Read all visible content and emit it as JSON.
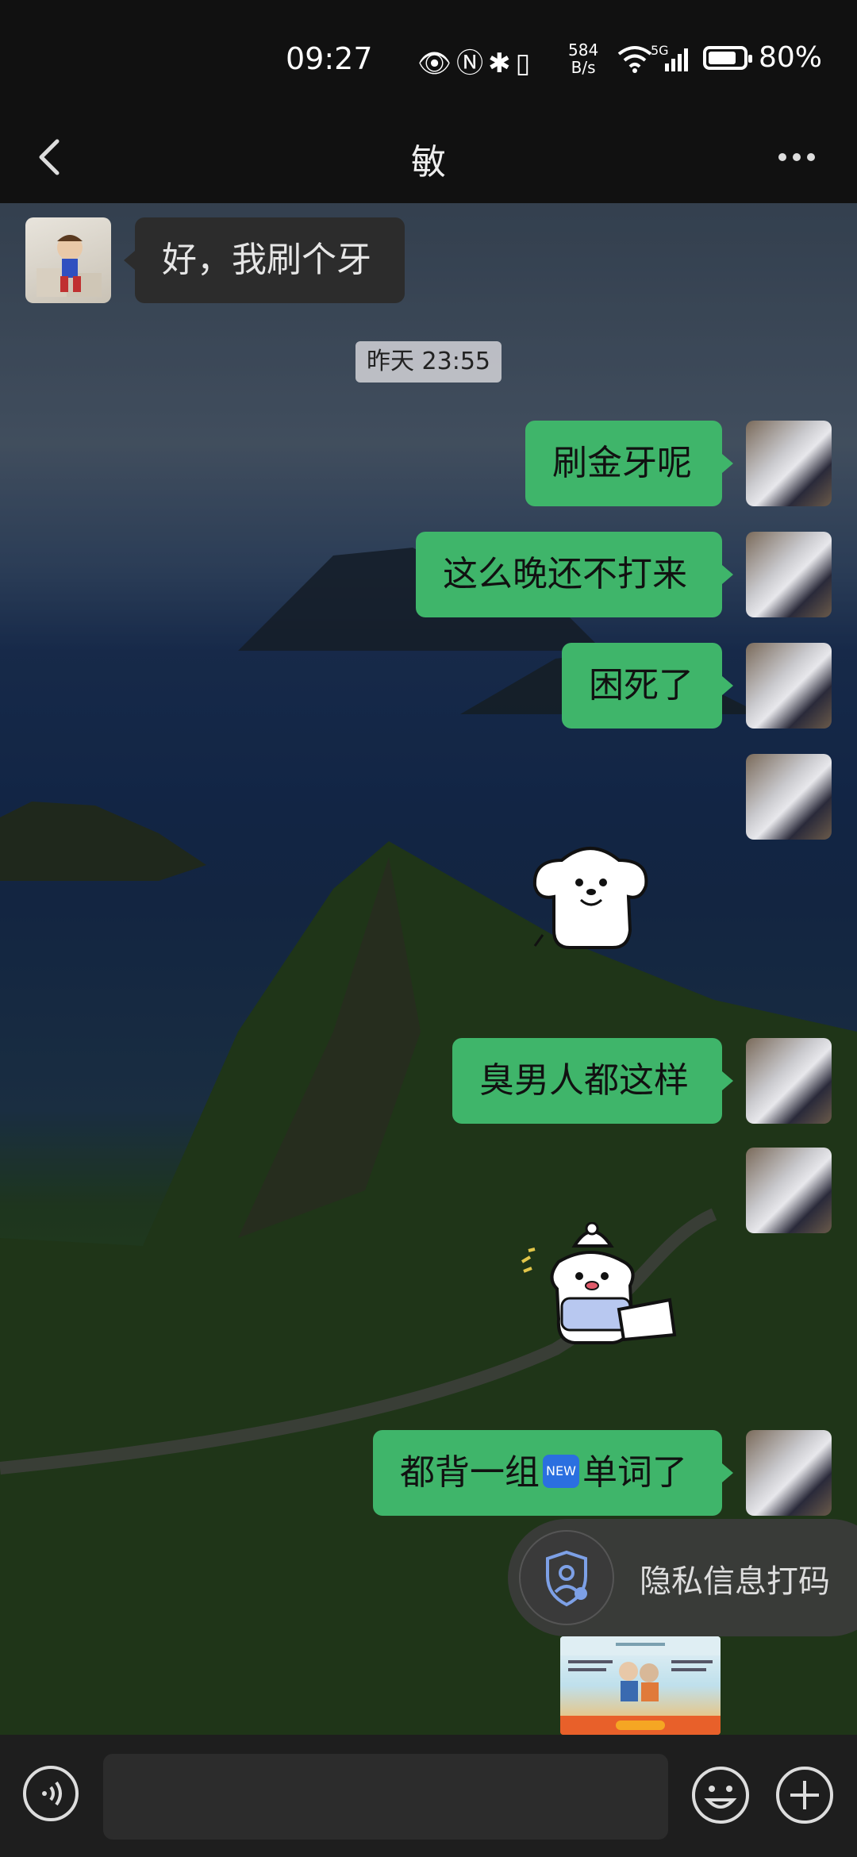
{
  "status_bar": {
    "time": "09:27",
    "net_speed_value": "584",
    "net_speed_unit": "B/s",
    "network": "5G",
    "battery_percent": "80%",
    "battery_level": 0.8
  },
  "header": {
    "back_icon": "chevron-left-icon",
    "title": "敏",
    "more_icon": "more-dots-icon"
  },
  "messages": [
    {
      "sender": "contact",
      "type": "text",
      "text": "好，我刷个牙"
    },
    {
      "type": "timestamp",
      "text": "昨天 23:55"
    },
    {
      "sender": "me",
      "type": "text",
      "text": "刷金牙呢"
    },
    {
      "sender": "me",
      "type": "text",
      "text": "这么晚还不打来"
    },
    {
      "sender": "me",
      "type": "text",
      "text": "困死了"
    },
    {
      "sender": "me",
      "type": "sticker",
      "sticker": "white-dog-sticker"
    },
    {
      "sender": "me",
      "type": "text",
      "text": "臭男人都这样"
    },
    {
      "sender": "me",
      "type": "sticker",
      "sticker": "dog-with-pillow-sticker"
    },
    {
      "sender": "me",
      "type": "text",
      "text_before": "都背一组",
      "emoji": "NEW",
      "text_after": "单词了"
    },
    {
      "sender": "me",
      "type": "image",
      "image": "image-thumbnail"
    }
  ],
  "privacy_toast": {
    "icon": "shield-user-icon",
    "label": "隐私信息打码"
  },
  "input_bar": {
    "voice_icon": "voice-icon",
    "message_value": "",
    "emoji_icon": "emoji-icon",
    "plus_icon": "plus-icon"
  },
  "colors": {
    "bubble_out": "#3fb56a",
    "bubble_in": "#2c2c2c",
    "bar_bg": "#111111"
  }
}
